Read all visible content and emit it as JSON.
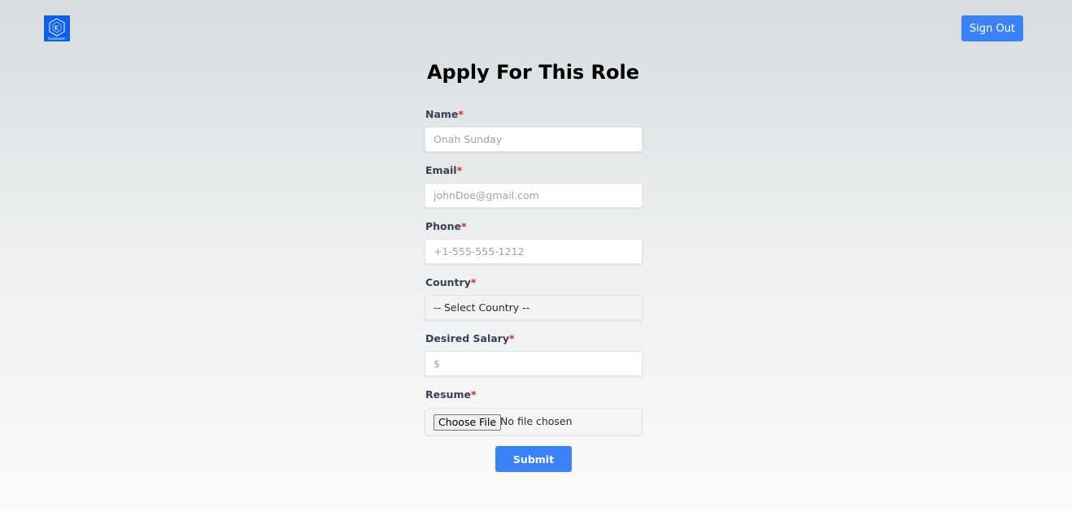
{
  "header": {
    "logo_text": "Kudoswam",
    "sign_out_label": "Sign Out"
  },
  "form": {
    "title": "Apply For This Role",
    "required_marker": "*",
    "name": {
      "label": "Name",
      "placeholder": "Onah Sunday"
    },
    "email": {
      "label": "Email",
      "placeholder": "johnDoe@gmail.com"
    },
    "phone": {
      "label": "Phone",
      "placeholder": "+1-555-555-1212"
    },
    "country": {
      "label": "Country",
      "selected": "-- Select Country --"
    },
    "salary": {
      "label": "Desired Salary",
      "placeholder": "$"
    },
    "resume": {
      "label": "Resume",
      "button_label": "Choose File",
      "status": "No file chosen"
    },
    "submit_label": "Submit"
  },
  "colors": {
    "accent": "#3b82f6",
    "logo_bg": "#0b5fe8",
    "required": "#dc2626"
  },
  "icons": [
    "logo-icon"
  ]
}
